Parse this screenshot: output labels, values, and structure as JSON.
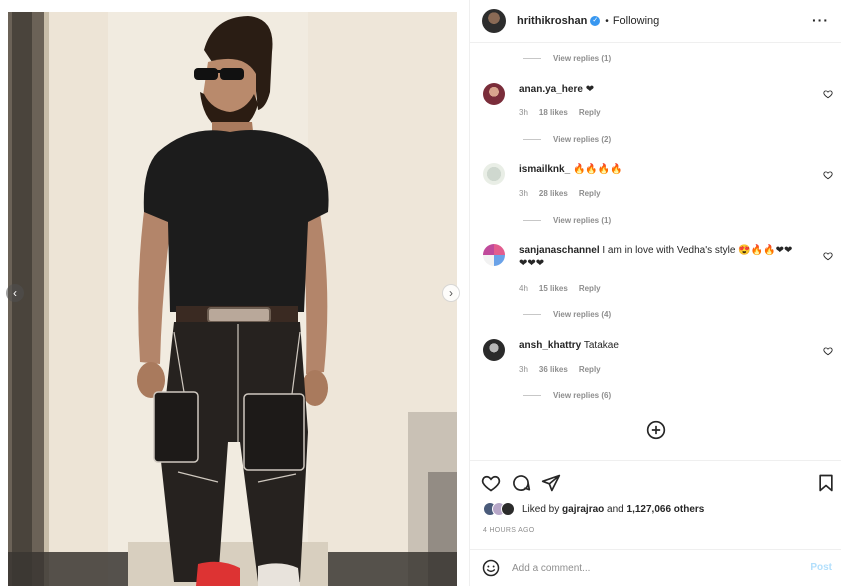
{
  "post": {
    "username": "hrithikroshan",
    "follow_state": "Following",
    "separator": "•",
    "more_icon": "more-horizontal-icon"
  },
  "comments": [
    {
      "type": "replies",
      "label": "View replies (1)"
    },
    {
      "type": "comment",
      "user": "anan.ya_here",
      "text": "❤",
      "age": "3h",
      "likes": "18 likes",
      "reply": "Reply"
    },
    {
      "type": "replies",
      "label": "View replies (2)"
    },
    {
      "type": "comment",
      "user": "ismailknk_",
      "text": "🔥🔥🔥🔥",
      "age": "3h",
      "likes": "28 likes",
      "reply": "Reply"
    },
    {
      "type": "replies",
      "label": "View replies (1)"
    },
    {
      "type": "comment",
      "user": "sanjanaschannel",
      "text": "I am in love with Vedha's style 😍🔥🔥❤❤",
      "text2": "❤❤❤",
      "age": "4h",
      "likes": "15 likes",
      "reply": "Reply"
    },
    {
      "type": "replies",
      "label": "View replies (4)"
    },
    {
      "type": "comment",
      "user": "ansh_khattry",
      "text": "Tatakae",
      "age": "3h",
      "likes": "36 likes",
      "reply": "Reply"
    },
    {
      "type": "replies",
      "label": "View replies (6)"
    }
  ],
  "likes": {
    "prefix": "Liked by ",
    "user": "gajrajrao",
    "middle": " and ",
    "count": "1,127,066 others"
  },
  "time_ago": "4 HOURS AGO",
  "comment_box": {
    "placeholder": "Add a comment...",
    "post_label": "Post"
  },
  "colors": {
    "accent_blue": "#3897f0",
    "post_disabled": "#b2dffc",
    "secondary_text": "#8e8e8e"
  }
}
